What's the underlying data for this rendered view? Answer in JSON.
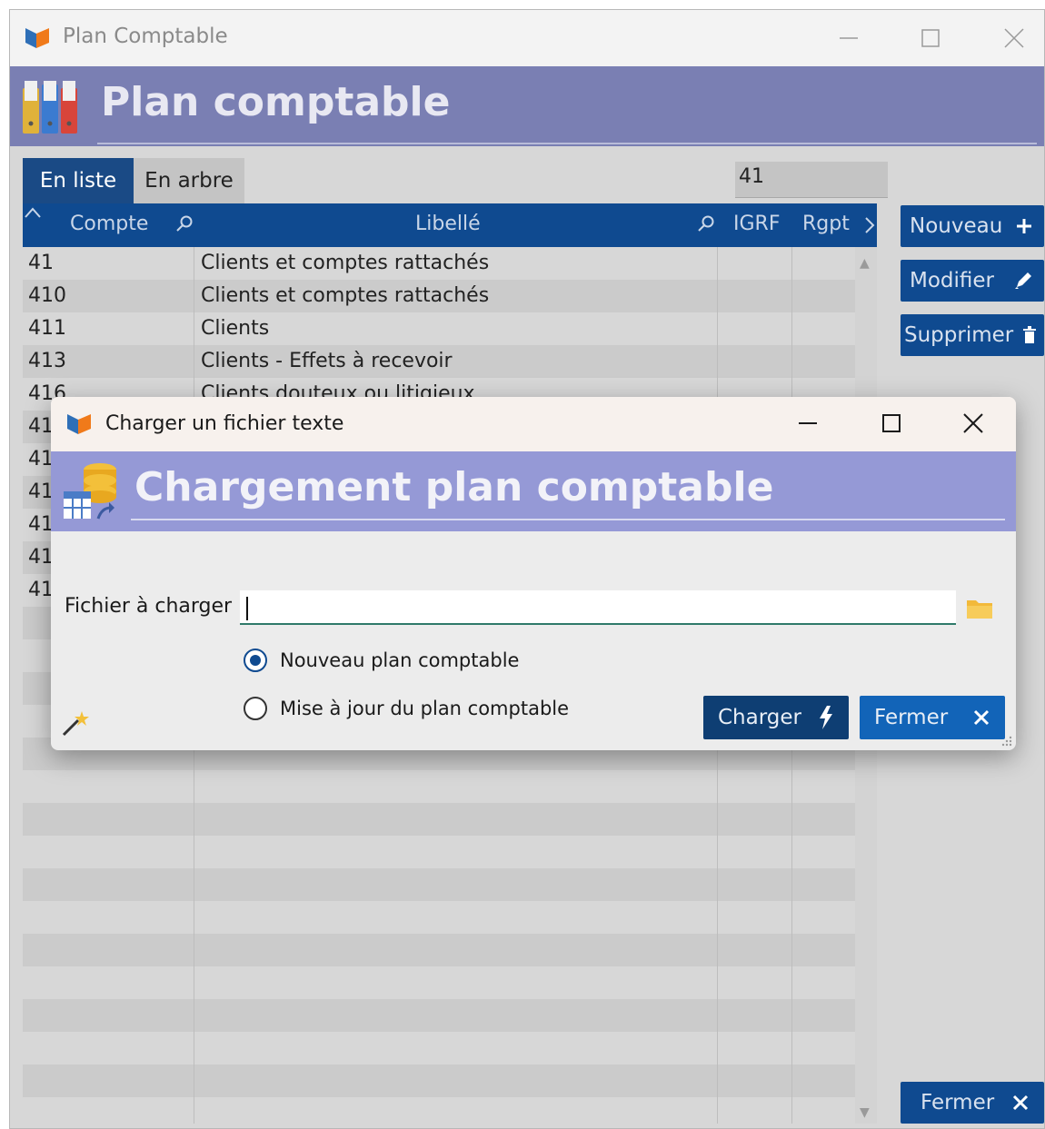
{
  "window": {
    "title": "Plan Comptable",
    "header_title": "Plan comptable"
  },
  "tabs": [
    {
      "label": "En liste",
      "active": true
    },
    {
      "label": "En arbre",
      "active": false
    }
  ],
  "search": {
    "value": "41"
  },
  "grid": {
    "columns": [
      "Compte",
      "Libellé",
      "IGRF",
      "Rgpt"
    ],
    "rows": [
      {
        "compte": "41",
        "libelle": "Clients et comptes rattachés"
      },
      {
        "compte": "410",
        "libelle": "Clients et comptes rattachés"
      },
      {
        "compte": "411",
        "libelle": "Clients"
      },
      {
        "compte": "413",
        "libelle": "Clients - Effets à recevoir"
      },
      {
        "compte": "416",
        "libelle": "Clients douteux ou litigieux"
      },
      {
        "compte": "41",
        "libelle": ""
      },
      {
        "compte": "41",
        "libelle": ""
      },
      {
        "compte": "41",
        "libelle": ""
      },
      {
        "compte": "41",
        "libelle": ""
      },
      {
        "compte": "41",
        "libelle": ""
      },
      {
        "compte": "41",
        "libelle": ""
      }
    ]
  },
  "side_buttons": {
    "nouveau": "Nouveau",
    "modifier": "Modifier",
    "supprimer": "Supprimer",
    "fermer": "Fermer"
  },
  "dialog": {
    "title": "Charger un fichier texte",
    "header_title": "Chargement plan comptable",
    "file_label": "Fichier à charger",
    "file_value": "",
    "options": [
      {
        "label": "Nouveau plan comptable",
        "selected": true
      },
      {
        "label": "Mise à jour du plan comptable",
        "selected": false
      }
    ],
    "charger_label": "Charger",
    "fermer_label": "Fermer"
  },
  "colors": {
    "header_bg": "#7a7fb3",
    "dialog_header_bg": "#9599d6",
    "primary_blue": "#0f4a90",
    "charger_bg": "#0e3e73",
    "fermer_bg": "#1264b8"
  },
  "icons": [
    "app-logo-icon",
    "binders-icon",
    "search-icon",
    "plus-icon",
    "pencil-icon",
    "trash-icon",
    "close-icon",
    "database-table-icon",
    "folder-icon",
    "lightning-icon",
    "magic-wand-icon",
    "chevron-right-icon",
    "sort-up-icon"
  ]
}
